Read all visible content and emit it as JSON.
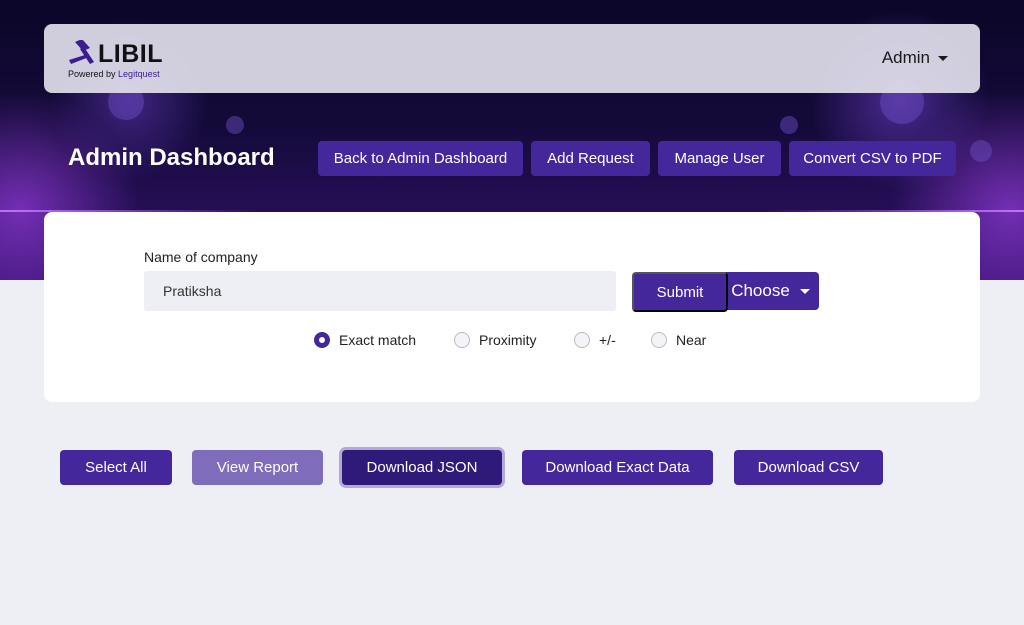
{
  "app": {
    "logo_text": "LIBIL",
    "powered_by_prefix": "Powered by",
    "powered_by_brand": "Legitquest"
  },
  "navbar": {
    "user_menu_label": "Admin"
  },
  "header": {
    "title": "Admin Dashboard",
    "buttons": [
      "Back to Admin Dashboard",
      "Add Request",
      "Manage User",
      "Convert CSV to PDF"
    ]
  },
  "search_form": {
    "label": "Name of company",
    "company_value": "Pratiksha",
    "submit_label": "Submit",
    "choose_label": "Choose",
    "match_options": [
      "Exact match",
      "Proximity",
      "+/-",
      "Near"
    ],
    "selected_option": "Exact match"
  },
  "actions": [
    "Select All",
    "View Report",
    "Download JSON",
    "Download Exact Data",
    "Download CSV"
  ],
  "colors": {
    "primary": "#44279a",
    "primary_light": "#7f6cba",
    "page_bg": "#eeeff4",
    "hero_dark": "#0c0628"
  }
}
